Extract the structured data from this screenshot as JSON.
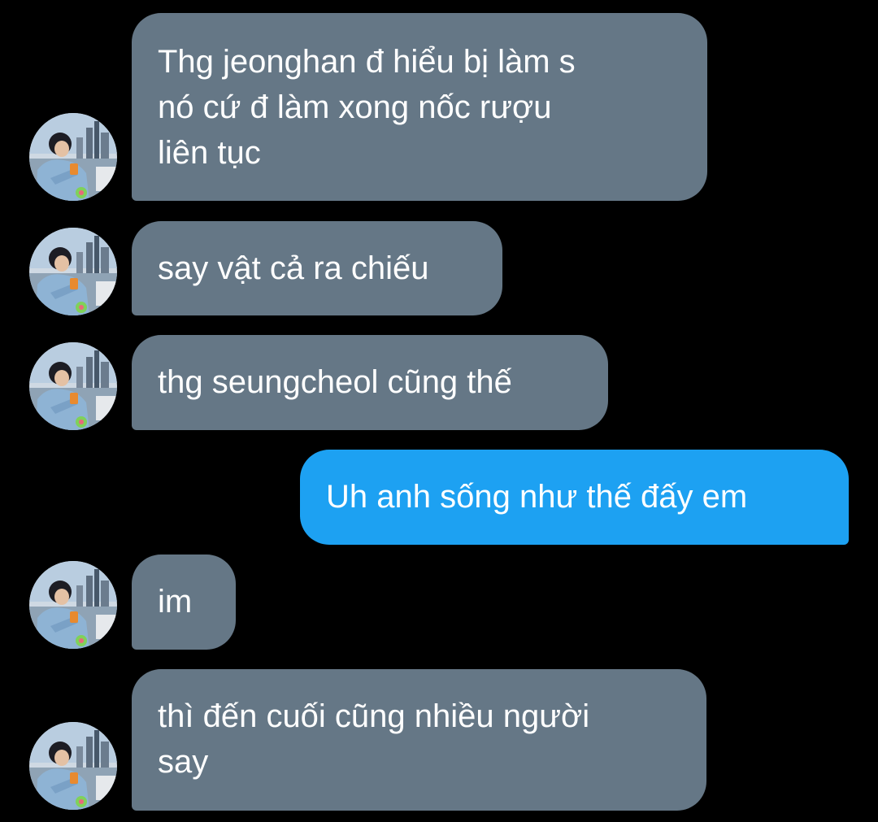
{
  "conversation": {
    "messages": [
      {
        "direction": "in",
        "text": "Thg jeonghan đ hiểu bị làm s\nnó cứ đ làm xong nốc rượu\nliên tục"
      },
      {
        "direction": "in",
        "text": "say vật cả ra chiếu"
      },
      {
        "direction": "in",
        "text": "thg seungcheol cũng thế"
      },
      {
        "direction": "out",
        "text": "Uh anh sống như thế đấy em"
      },
      {
        "direction": "in",
        "text": "im"
      },
      {
        "direction": "in",
        "text": "thì đến cuối cũng nhiều người\nsay"
      }
    ]
  },
  "colors": {
    "background": "#000000",
    "incoming_bubble": "#657786",
    "outgoing_bubble": "#1da1f2",
    "text": "#ffffff"
  },
  "icons": {
    "avatar": "avatar-photo-icon"
  }
}
